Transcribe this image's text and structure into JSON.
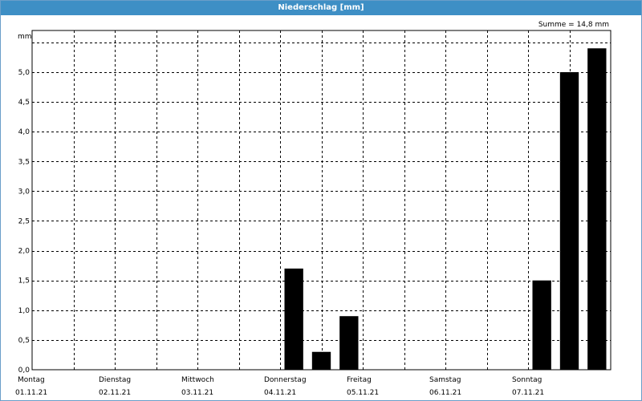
{
  "title": "Niederschlag [mm]",
  "summary": "Summe = 14,8 mm",
  "chart_data": {
    "type": "bar",
    "title": "Niederschlag [mm]",
    "ylabel": "mm",
    "ylim": [
      0,
      5.7
    ],
    "yticks": [
      0,
      0.5,
      1.0,
      1.5,
      2.0,
      2.5,
      3.0,
      3.5,
      4.0,
      4.5,
      5.0
    ],
    "ytick_labels": [
      "0,0",
      "0,5",
      "1,0",
      "1,5",
      "2,0",
      "2,5",
      "3,0",
      "3,5",
      "4,0",
      "4,5",
      "5,0"
    ],
    "days": [
      {
        "name": "Montag",
        "date": "01.11.21"
      },
      {
        "name": "Dienstag",
        "date": "02.11.21"
      },
      {
        "name": "Mittwoch",
        "date": "03.11.21"
      },
      {
        "name": "Donnerstag",
        "date": "04.11.21"
      },
      {
        "name": "Freitag",
        "date": "05.11.21"
      },
      {
        "name": "Samstag",
        "date": "06.11.21"
      },
      {
        "name": "Sonntag",
        "date": "07.11.21"
      }
    ],
    "x_start": "01.11.21 00:00",
    "x_end": "08.11.21 00:00",
    "bars": [
      {
        "time": "04.11.21 00:00",
        "value": 1.7
      },
      {
        "time": "04.11.21 08:00",
        "value": 0.3
      },
      {
        "time": "04.11.21 16:00",
        "value": 0.9
      },
      {
        "time": "07.11.21 00:00",
        "value": 1.5
      },
      {
        "time": "07.11.21 08:00",
        "value": 5.0
      },
      {
        "time": "07.11.21 16:00",
        "value": 5.4
      }
    ],
    "grid": true,
    "colors": {
      "bar": "#000000",
      "title_bar": "#3e8fc5",
      "grid": "#000000"
    }
  }
}
